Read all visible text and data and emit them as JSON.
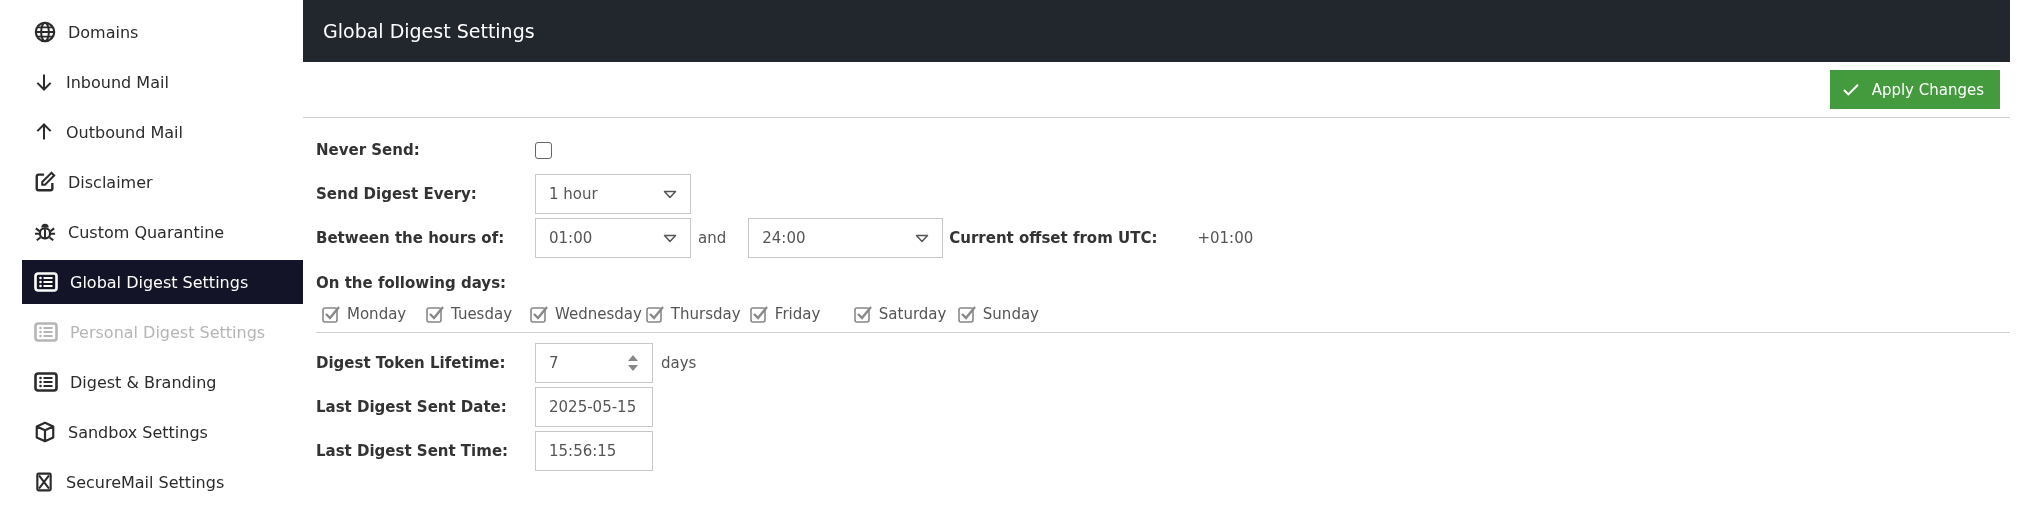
{
  "sidebar": {
    "items": [
      {
        "label": "Domains",
        "selected": false,
        "disabled": false
      },
      {
        "label": "Inbound Mail",
        "selected": false,
        "disabled": false
      },
      {
        "label": "Outbound Mail",
        "selected": false,
        "disabled": false
      },
      {
        "label": "Disclaimer",
        "selected": false,
        "disabled": false
      },
      {
        "label": "Custom Quarantine",
        "selected": false,
        "disabled": false
      },
      {
        "label": "Global Digest Settings",
        "selected": true,
        "disabled": false
      },
      {
        "label": "Personal Digest Settings",
        "selected": false,
        "disabled": true
      },
      {
        "label": "Digest & Branding",
        "selected": false,
        "disabled": false
      },
      {
        "label": "Sandbox Settings",
        "selected": false,
        "disabled": false
      },
      {
        "label": "SecureMail Settings",
        "selected": false,
        "disabled": false
      }
    ]
  },
  "header": {
    "title": "Global Digest Settings"
  },
  "apply_button": {
    "label": "Apply Changes"
  },
  "never_send": {
    "label": "Never Send:",
    "checked": false
  },
  "send_every": {
    "label": "Send Digest Every:",
    "value": "1 hour"
  },
  "hours": {
    "label": "Between the hours of:",
    "from": "01:00",
    "and": "and",
    "to": "24:00",
    "offset_label": "Current offset from UTC:",
    "offset_value": "+01:00"
  },
  "days": {
    "label": "On the following days:",
    "items": [
      {
        "label": "Monday",
        "checked": true
      },
      {
        "label": "Tuesday",
        "checked": true
      },
      {
        "label": "Wednesday",
        "checked": true
      },
      {
        "label": "Thursday",
        "checked": true
      },
      {
        "label": "Friday",
        "checked": true
      },
      {
        "label": "Saturday",
        "checked": true
      },
      {
        "label": "Sunday",
        "checked": true
      }
    ]
  },
  "token_lifetime": {
    "label": "Digest Token Lifetime:",
    "value": "7",
    "unit": "days"
  },
  "last_date": {
    "label": "Last Digest Sent Date:",
    "value": "2025-05-15"
  },
  "last_time": {
    "label": "Last Digest Sent Time:",
    "value": "15:56:15"
  }
}
